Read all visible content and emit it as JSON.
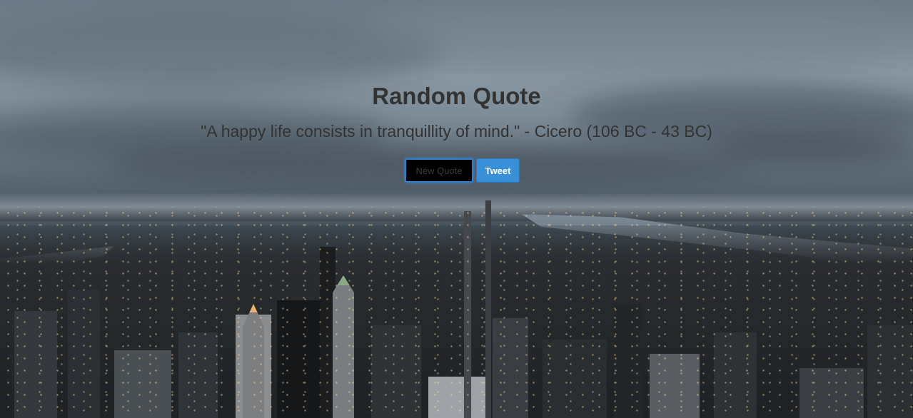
{
  "page": {
    "title": "Random Quote",
    "quote": "\"A happy life consists in tranquillity of mind.\" - Cicero (106 BC - 43 BC)"
  },
  "buttons": {
    "new_quote_label": "New Quote",
    "tweet_label": "Tweet"
  },
  "colors": {
    "text": "#333333",
    "tweet_button": "#3a8fd9",
    "new_quote_button": "#000000",
    "focus_ring": "#2f7fd0"
  },
  "background": {
    "description_icon": "city-skyline-photo"
  }
}
